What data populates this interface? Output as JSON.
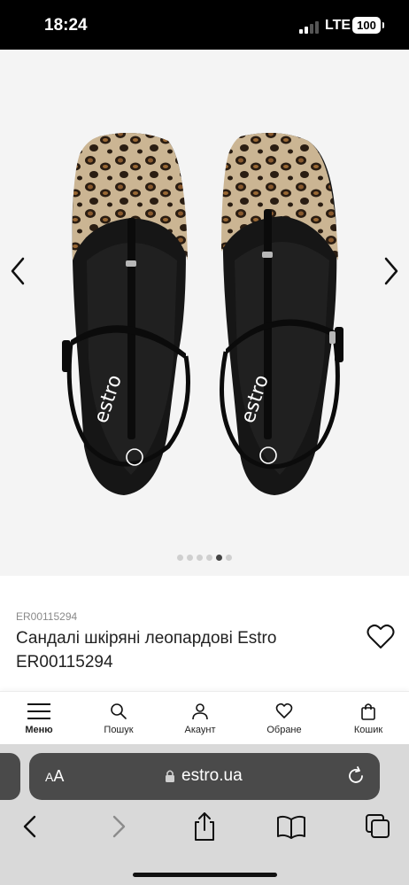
{
  "status_bar": {
    "time": "18:24",
    "network": "LTE",
    "battery": "100"
  },
  "gallery": {
    "image_alt": "leopard-print-sandals-photo",
    "brand_on_insole": "estro",
    "slide_count": 6,
    "active_slide": 5
  },
  "product": {
    "sku": "ER00115294",
    "title": "Сандалі шкіряні леопардові Estro ER00115294"
  },
  "bottom_nav": {
    "items": [
      {
        "label": "Меню",
        "icon": "menu-icon"
      },
      {
        "label": "Пошук",
        "icon": "search-icon"
      },
      {
        "label": "Акаунт",
        "icon": "account-icon"
      },
      {
        "label": "Обране",
        "icon": "heart-icon"
      },
      {
        "label": "Кошик",
        "icon": "bag-icon"
      }
    ]
  },
  "browser": {
    "text_size_label_small": "A",
    "text_size_label_large": "A",
    "url": "estro.ua"
  },
  "colors": {
    "accent": "#000000",
    "gallery_bg": "#f4f4f4",
    "url_bar_bg": "#4a4a4a"
  }
}
